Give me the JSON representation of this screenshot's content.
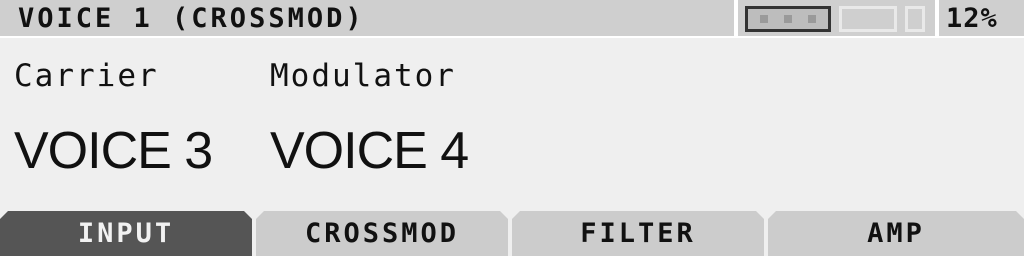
{
  "header": {
    "title": "VOICE 1 (CROSSMOD)",
    "percent_label": "12%",
    "level_percent": 12
  },
  "main": {
    "carrier": {
      "label": "Carrier",
      "value": "VOICE 3"
    },
    "modulator": {
      "label": "Modulator",
      "value": "VOICE 4"
    }
  },
  "tabs": [
    {
      "label": "INPUT",
      "active": true
    },
    {
      "label": "CROSSMOD",
      "active": false
    },
    {
      "label": "FILTER",
      "active": false
    },
    {
      "label": "AMP",
      "active": false
    }
  ],
  "colors": {
    "header_bg": "#cfcfcf",
    "body_bg": "#efefef",
    "tab_bg": "#cccccc",
    "tab_active_bg": "#555555",
    "text": "#111111"
  }
}
